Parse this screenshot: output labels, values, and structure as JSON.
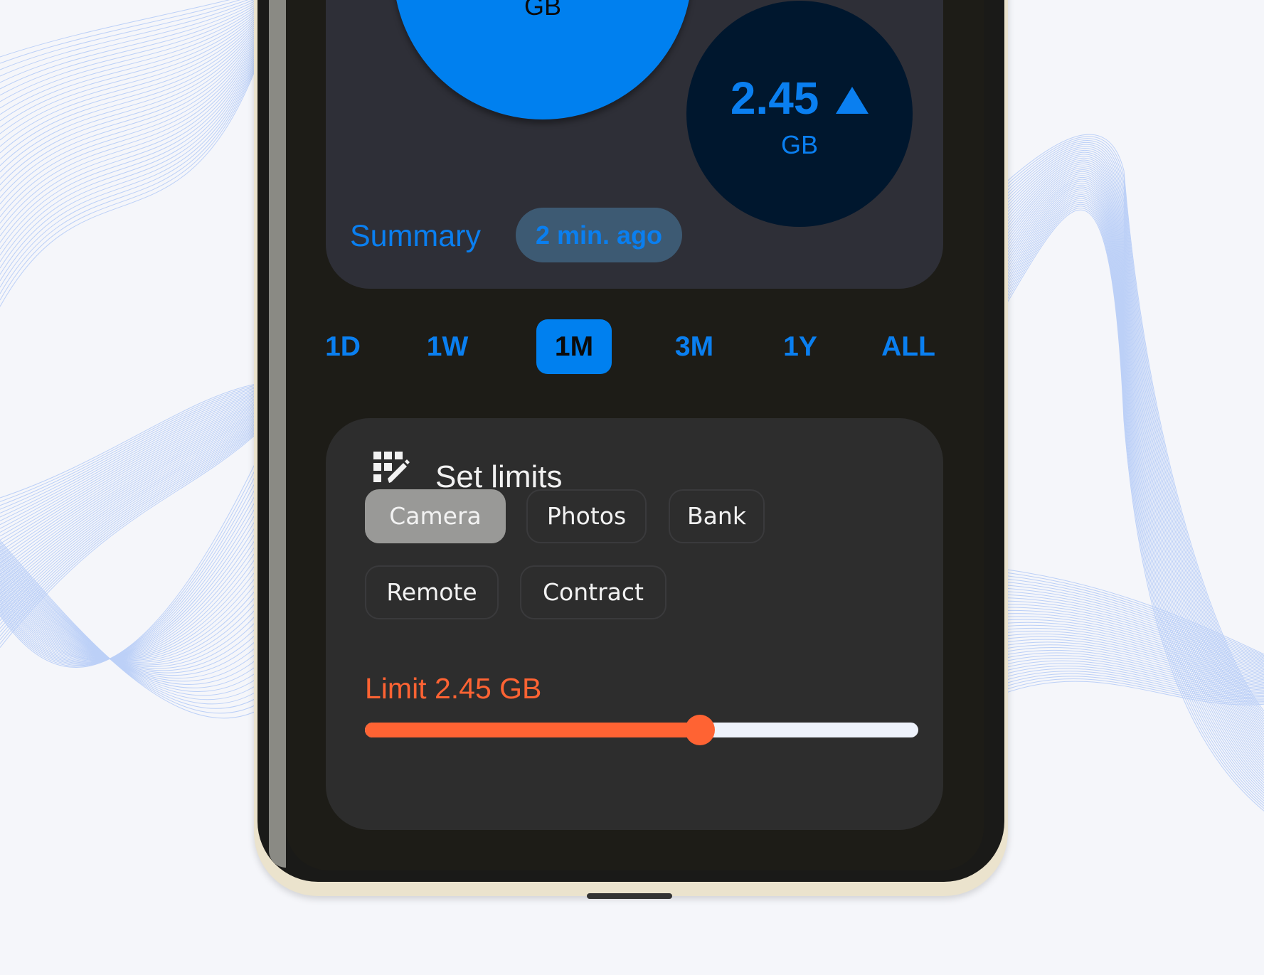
{
  "summary_card": {
    "top_circle_unit": "GB",
    "usage_value": "2.45",
    "usage_trend_icon": "triangle-up-icon",
    "usage_unit": "GB",
    "title": "Summary",
    "updated_badge": "2 min. ago"
  },
  "range_tabs": [
    {
      "label": "1D",
      "active": false
    },
    {
      "label": "1W",
      "active": false
    },
    {
      "label": "1M",
      "active": true
    },
    {
      "label": "3M",
      "active": false
    },
    {
      "label": "1Y",
      "active": false
    },
    {
      "label": "ALL",
      "active": false
    }
  ],
  "limits_card": {
    "icon": "grid-edit-icon",
    "title": "Set limits",
    "chips": [
      {
        "label": "Camera",
        "selected": true
      },
      {
        "label": "Photos",
        "selected": false
      },
      {
        "label": "Bank",
        "selected": false
      },
      {
        "label": "Remote",
        "selected": false
      },
      {
        "label": "Contract",
        "selected": false
      }
    ],
    "limit_label": "Limit 2.45 GB",
    "slider_fraction": 0.605
  },
  "colors": {
    "accent": "#0080ef",
    "limit": "#ff6333",
    "background": "#f5f6fa"
  }
}
